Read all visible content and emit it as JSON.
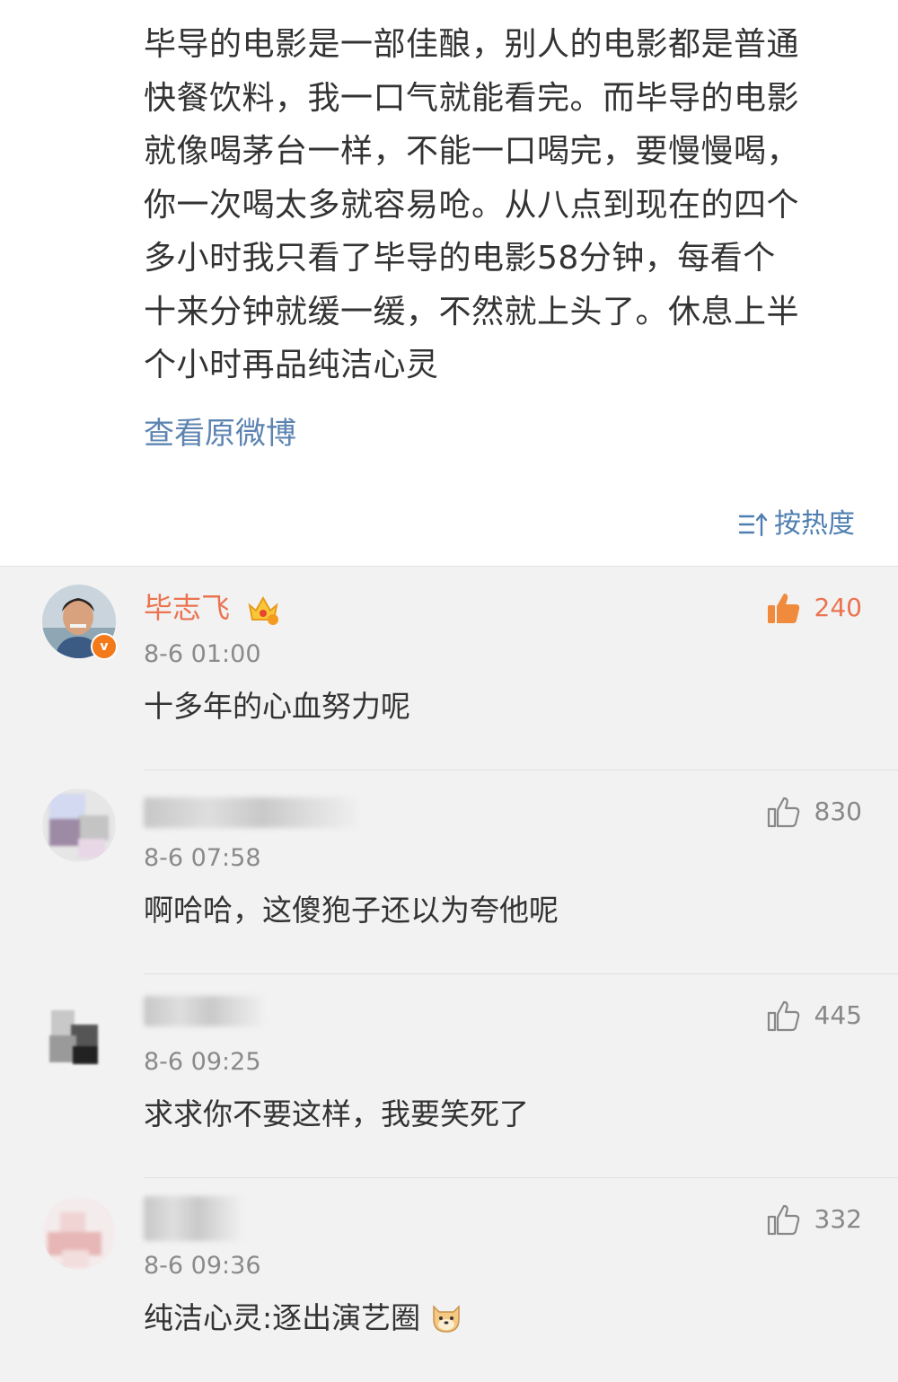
{
  "post": {
    "lines": [
      "毕导的电影是一部佳酿，别人的电影都是普通",
      "快餐饮料，我一口气就能看完。而毕导的电影",
      "就像喝茅台一样，不能一口喝完，要慢慢喝，",
      "你一次喝太多就容易呛。从八点到现在的四个",
      "多小时我只看了毕导的电影58分钟，每看个",
      "十来分钟就缓一缓，不然就上头了。休息上半",
      "个小时再品纯洁心灵"
    ],
    "view_original": "查看原微博"
  },
  "sort": {
    "label": "按热度",
    "icon": "sort-icon"
  },
  "colors": {
    "vip_name": "#eb7350",
    "link": "#5d84b1",
    "like_active": "#eb7350"
  },
  "comments": [
    {
      "name": "毕志飞",
      "verified": true,
      "crown": true,
      "time": "8-6 01:00",
      "text": "十多年的心血努力呢",
      "likes": "240",
      "liked": true
    },
    {
      "name": "",
      "time": "8-6 07:58",
      "text": "啊哈哈，这傻狍子还以为夸他呢",
      "likes": "830"
    },
    {
      "name": "",
      "time": "8-6 09:25",
      "text": "求求你不要这样，我要笑死了",
      "likes": "445"
    },
    {
      "name": "",
      "time": "8-6 09:36",
      "text": "纯洁心灵:逐出演艺圈",
      "likes": "332",
      "emoji": "doge-emoji"
    }
  ]
}
